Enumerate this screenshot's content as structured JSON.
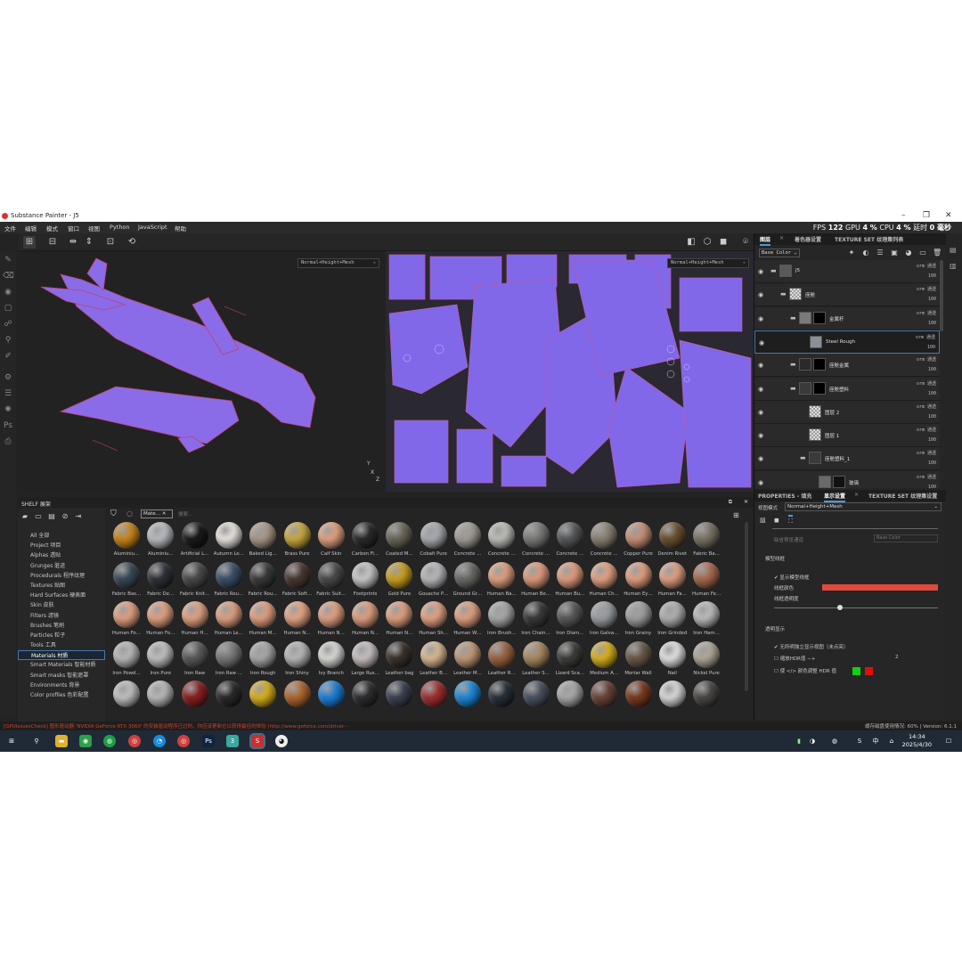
{
  "app": {
    "title": "Substance Painter - J5",
    "window_controls": [
      "–",
      "❐",
      "✕"
    ]
  },
  "menu": [
    "文件",
    "编辑",
    "模式",
    "窗口",
    "视图",
    "Python",
    "JavaScript",
    "帮助"
  ],
  "stats": {
    "fps_label": "FPS",
    "fps": "122",
    "gpu_label": "GPU",
    "gpu": "4 %",
    "cpu_label": "CPU",
    "cpu": "4 %",
    "latency_label": "延时",
    "latency": "0 毫秒"
  },
  "viewport": {
    "mode_3d": "Normal+Height+Mesh",
    "mode_2d": "Normal+Height+Mesh",
    "gizmo_y": "Y",
    "gizmo_x": "X",
    "gizmo_z": "Z"
  },
  "shelf": {
    "title": "SHELF 展架",
    "filter_chip": "Mate…",
    "search_placeholder": "搜索…",
    "categories": [
      {
        "label": "All 全部",
        "selected": false
      },
      {
        "label": "Project 项目",
        "selected": false
      },
      {
        "label": "Alphas 透贴",
        "selected": false
      },
      {
        "label": "Grunges 脏迹",
        "selected": false
      },
      {
        "label": "Procedurals 程序纹理",
        "selected": false
      },
      {
        "label": "Textures 贴图",
        "selected": false
      },
      {
        "label": "Hard Surfaces 硬表面",
        "selected": false
      },
      {
        "label": "Skin 皮肤",
        "selected": false
      },
      {
        "label": "Filters 滤镜",
        "selected": false
      },
      {
        "label": "Brushes 笔刷",
        "selected": false
      },
      {
        "label": "Particles 粒子",
        "selected": false
      },
      {
        "label": "Tools 工具",
        "selected": false
      },
      {
        "label": "Materials 材质",
        "selected": true
      },
      {
        "label": "Smart Materials 智能材质",
        "selected": false
      },
      {
        "label": "Smart masks 智能遮罩",
        "selected": false
      },
      {
        "label": "Environments 背景",
        "selected": false
      },
      {
        "label": "Color profiles 色彩配置",
        "selected": false
      }
    ],
    "materials": [
      {
        "label": "Aluminiu…",
        "color": "#c8861c"
      },
      {
        "label": "Aluminiu…",
        "color": "#b8bcc0"
      },
      {
        "label": "Artificial L…",
        "color": "#1a1a1a"
      },
      {
        "label": "Autumn Le…",
        "color": "#e8e4de"
      },
      {
        "label": "Baked Lig…",
        "color": "#a89888"
      },
      {
        "label": "Brass Pure",
        "color": "#c8a840"
      },
      {
        "label": "Calf Skin",
        "color": "#e0a080"
      },
      {
        "label": "Carbon Fi…",
        "color": "#2a2a2a"
      },
      {
        "label": "Coated M…",
        "color": "#6a6658"
      },
      {
        "label": "Cobalt Pure",
        "color": "#a8aab0"
      },
      {
        "label": "Concrete …",
        "color": "#a09c94"
      },
      {
        "label": "Concrete …",
        "color": "#bcbcb8"
      },
      {
        "label": "Concrete …",
        "color": "#7a7a78"
      },
      {
        "label": "Concrete …",
        "color": "#56585a"
      },
      {
        "label": "Concrete …",
        "color": "#8a8070"
      },
      {
        "label": "Copper Pure",
        "color": "#c89078"
      },
      {
        "label": "Denim Rivet",
        "color": "#6a5030"
      },
      {
        "label": "Fabric Ba…",
        "color": "#7a7264"
      },
      {
        "label": "Fabric Bas…",
        "color": "#3a4a58"
      },
      {
        "label": "Fabric De…",
        "color": "#2e3238"
      },
      {
        "label": "Fabric Knit…",
        "color": "#4a4a4a"
      },
      {
        "label": "Fabric Rou…",
        "color": "#3a5068"
      },
      {
        "label": "Fabric Rou…",
        "color": "#3a3a3a"
      },
      {
        "label": "Fabric Soft…",
        "color": "#4a3830"
      },
      {
        "label": "Fabric Suit…",
        "color": "#4a4a4a"
      },
      {
        "label": "Footprints",
        "color": "#c8c8c8"
      },
      {
        "label": "Gold Pure",
        "color": "#c8a020"
      },
      {
        "label": "Gouache P…",
        "color": "#b8b8bc"
      },
      {
        "label": "Ground Gr…",
        "color": "#6a6a66"
      },
      {
        "label": "Human Ba…",
        "color": "#e0a080"
      },
      {
        "label": "Human Be…",
        "color": "#e09a7c"
      },
      {
        "label": "Human Bu…",
        "color": "#e09c80"
      },
      {
        "label": "Human Ch…",
        "color": "#e2a282"
      },
      {
        "label": "Human Ey…",
        "color": "#e09e80"
      },
      {
        "label": "Human Fa…",
        "color": "#dea082"
      },
      {
        "label": "Human Fe…",
        "color": "#a86a50"
      },
      {
        "label": "Human Fo…",
        "color": "#e0a080"
      },
      {
        "label": "Human Fo…",
        "color": "#e2a080"
      },
      {
        "label": "Human H…",
        "color": "#e0a282"
      },
      {
        "label": "Human Le…",
        "color": "#dfa080"
      },
      {
        "label": "Human M…",
        "color": "#e0a080"
      },
      {
        "label": "Human N…",
        "color": "#e4a484"
      },
      {
        "label": "Human N…",
        "color": "#e0a082"
      },
      {
        "label": "Human N…",
        "color": "#dea080"
      },
      {
        "label": "Human N…",
        "color": "#e0a080"
      },
      {
        "label": "Human Sh…",
        "color": "#e2a284"
      },
      {
        "label": "Human W…",
        "color": "#e0a080"
      },
      {
        "label": "Iron Brush…",
        "color": "#a8a8a8"
      },
      {
        "label": "Iron Chain…",
        "color": "#3a3a3a"
      },
      {
        "label": "Iron Diam…",
        "color": "#585858"
      },
      {
        "label": "Iron Galva…",
        "color": "#9a9ea2"
      },
      {
        "label": "Iron Grainy",
        "color": "#a0a0a0"
      },
      {
        "label": "Iron Grinded",
        "color": "#b0b0b0"
      },
      {
        "label": "Iron Ham…",
        "color": "#bcbcbc"
      },
      {
        "label": "Iron Powd…",
        "color": "#b8b8b8"
      },
      {
        "label": "Iron Pure",
        "color": "#c0c0c0"
      },
      {
        "label": "Iron Raw",
        "color": "#5a5a5a"
      },
      {
        "label": "Iron Raw …",
        "color": "#787878"
      },
      {
        "label": "Iron Rough",
        "color": "#a8a8a8"
      },
      {
        "label": "Iron Shiny",
        "color": "#b8b8b8"
      },
      {
        "label": "Ivy Branch",
        "color": "#d8d8d4"
      },
      {
        "label": "Large Rus…",
        "color": "#c8c0c0"
      },
      {
        "label": "Leather bag",
        "color": "#3a322c"
      },
      {
        "label": "Leather B…",
        "color": "#d8b890"
      },
      {
        "label": "Leather M…",
        "color": "#c09a78"
      },
      {
        "label": "Leather R…",
        "color": "#9a6440"
      },
      {
        "label": "Leather S…",
        "color": "#a88a60"
      },
      {
        "label": "Lizard Sca…",
        "color": "#3c3e3a"
      },
      {
        "label": "Medium A…",
        "color": "#d8b020"
      },
      {
        "label": "Mortar Wall",
        "color": "#6a5a48"
      },
      {
        "label": "Nail",
        "color": "#e0e0e0"
      },
      {
        "label": "Nickel Pure",
        "color": "#b0a898"
      },
      {
        "label": "",
        "color": "#c0c0c0"
      },
      {
        "label": "",
        "color": "#b8b8b8"
      },
      {
        "label": "",
        "color": "#8a2020"
      },
      {
        "label": "",
        "color": "#2a2a2a"
      },
      {
        "label": "",
        "color": "#d8b020"
      },
      {
        "label": "",
        "color": "#b06830"
      },
      {
        "label": "",
        "color": "#1e7ed8"
      },
      {
        "label": "",
        "color": "#2e2e30"
      },
      {
        "label": "",
        "color": "#3a4250"
      },
      {
        "label": "",
        "color": "#a03030"
      },
      {
        "label": "",
        "color": "#1e88d8"
      },
      {
        "label": "",
        "color": "#28303a"
      },
      {
        "label": "",
        "color": "#4a5260"
      },
      {
        "label": "",
        "color": "#a8a8a8"
      },
      {
        "label": "",
        "color": "#6a4438"
      },
      {
        "label": "",
        "color": "#7a3a20"
      },
      {
        "label": "",
        "color": "#d8d8d8"
      },
      {
        "label": "",
        "color": "#4a4844"
      }
    ]
  },
  "right_panel": {
    "tabs_top": [
      "图层",
      "着色器设置",
      "TEXTURE SET 纹理集列表"
    ],
    "channel_select": "Base Color",
    "layers": [
      {
        "name": "J5",
        "blend": "orm 通透",
        "opacity": "100",
        "indent": 0,
        "thumb": "#5a5a5a",
        "mask": "",
        "folder": true,
        "selected": false
      },
      {
        "name": "座舱",
        "blend": "orm 通透",
        "opacity": "100",
        "indent": 1,
        "thumb": "checker",
        "mask": "",
        "folder": true,
        "selected": false
      },
      {
        "name": "金属杆",
        "blend": "orm 通透",
        "opacity": "100",
        "indent": 2,
        "thumb": "#7a7a7a",
        "mask": "#000000",
        "folder": true,
        "selected": false
      },
      {
        "name": "Steel Rough",
        "blend": "orm 通透",
        "opacity": "100",
        "indent": 3,
        "thumb": "#8a9098",
        "mask": "",
        "folder": false,
        "selected": true
      },
      {
        "name": "座舱金属",
        "blend": "orm 通透",
        "opacity": "100",
        "indent": 2,
        "thumb": "#2a2a2a",
        "mask": "#000000",
        "folder": true,
        "selected": false
      },
      {
        "name": "座舱塑料",
        "blend": "orm 通透",
        "opacity": "100",
        "indent": 2,
        "thumb": "#3a3a3a",
        "mask": "#000000",
        "folder": true,
        "selected": false
      },
      {
        "name": "图层 2",
        "blend": "orm 通透",
        "opacity": "100",
        "indent": 3,
        "thumb": "checker",
        "mask": "",
        "folder": false,
        "selected": false
      },
      {
        "name": "图层 1",
        "blend": "orm 通透",
        "opacity": "100",
        "indent": 3,
        "thumb": "checker",
        "mask": "",
        "folder": false,
        "selected": false
      },
      {
        "name": "座舱塑料_1",
        "blend": "orm 通透",
        "opacity": "100",
        "indent": 3,
        "thumb": "#3a3a3a",
        "mask": "",
        "folder": true,
        "selected": false
      },
      {
        "name": "玻璃",
        "blend": "orm 通透",
        "opacity": "100",
        "indent": 4,
        "thumb": "#6a6a6a",
        "mask": "#111111",
        "folder": false,
        "selected": false
      }
    ],
    "tabs_props": [
      "PROPERTIES - 填充",
      "显示设置",
      "TEXTURE SET 纹理集设置"
    ],
    "view_mode_label": "视图模式",
    "view_mode_value": "Normal+Height+Mesh",
    "channel_label": "缺省预览通道",
    "channel_value": "Base Color",
    "wireframe_header": "模型线框",
    "show_wireframe": "显示模型线框",
    "wireframe_color": "线框颜色",
    "wireframe_color_value": "#e04a3a",
    "wireframe_opacity": "线框透明度",
    "wireframe_opacity_level": 0.4,
    "transparency_header": "透明显示",
    "isolate_label": "无所明独立显示视图（未点亮）",
    "scale_label": "缩放HDR值",
    "scale_value": "2",
    "color_row": "使 </> 颜色调整 HDR 值",
    "color_a": "#10d010",
    "color_b": "#e01010"
  },
  "status": {
    "left": "[GPUIssuesCheck] 图形驱动器 'NVIDIA GeForce RTX 3060' 的安装驱动程序已过时。你应该更新它以获得最佳的体验 (http://www.geforce.com/driver···",
    "right": "缓存磁盘使用情况:  60%  |  Version: 6.1.1"
  },
  "taskbar": {
    "time": "14:34",
    "date": "2025/4/30"
  }
}
